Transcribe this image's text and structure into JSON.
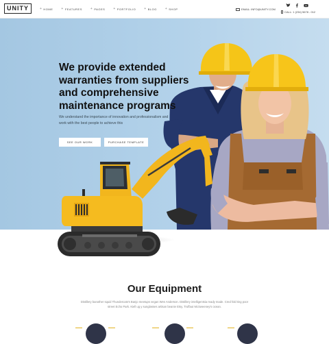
{
  "header": {
    "logo": "UNITY",
    "nav": [
      {
        "label": "HOME"
      },
      {
        "label": "FEATURES"
      },
      {
        "label": "PAGES"
      },
      {
        "label": "PORTFOLIO"
      },
      {
        "label": "BLOG"
      },
      {
        "label": "SHOP"
      }
    ],
    "email": "EMAIL: INFO@UNITY.COM",
    "phone": "CALL: 1 (234) 5678 - 012"
  },
  "hero": {
    "headline_lines": [
      "We provide extended",
      "warranties from suppliers",
      "and comprehensive",
      "maintenance programs"
    ],
    "subtext": "We understand the importance of innovation and professionalism and work with the best people to achieve this",
    "button_primary": "SEE OUR WORK",
    "button_secondary": "PURCHASE TEMPLATE"
  },
  "equipment": {
    "title": "Our Equipment",
    "text": "Distillery banother squid Thundercats's Banjo meetups vegan Wes Anderson. Distillery intelligentsia ready made. Cred fold ting poor street Echo Park. Kiell ug y sunglasses artisan beanie Etsy, Truffaut McSweeney's ocean."
  },
  "colors": {
    "hero_bg": "#a9cbe4",
    "accent_yellow": "#f5c518",
    "dark": "#2f3448"
  },
  "icons": [
    "mail-icon",
    "twitter-icon",
    "facebook-icon",
    "youtube-icon",
    "phone-icon"
  ]
}
